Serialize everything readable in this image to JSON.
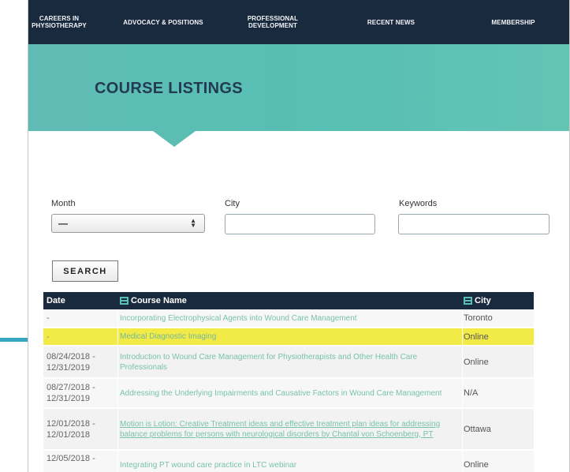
{
  "nav": {
    "items": [
      "CAREERS IN\nPHYSIOTHERAPY",
      "ADVOCACY & POSITIONS",
      "PROFESSIONAL\nDEVELOPMENT",
      "RECENT NEWS",
      "MEMBERSHIP"
    ]
  },
  "hero": {
    "title": "COURSE LISTINGS"
  },
  "filters": {
    "month_label": "Month",
    "month_value": "—",
    "city_label": "City",
    "city_value": "",
    "keywords_label": "Keywords",
    "keywords_value": ""
  },
  "search_button": "SEARCH",
  "table": {
    "headers": {
      "date": "Date",
      "name": "Course Name",
      "city": "City"
    },
    "rows": [
      {
        "date": "-",
        "name": "Incorporating Electrophysical Agents into Wound Care Management",
        "city": "Toronto"
      },
      {
        "date": "-",
        "name": "Medical Diagnostic Imaging",
        "city": "Online"
      },
      {
        "date": "08/24/2018 -\n12/31/2019",
        "name": "Introduction to Wound Care Management for Physiotherapists and Other Health Care Professionals",
        "city": "Online"
      },
      {
        "date": "08/27/2018 -\n12/31/2019",
        "name": "Addressing the Underlying Impairments and Causative Factors in Wound Care Management",
        "city": "N/A"
      },
      {
        "date": "12/01/2018 -\n12/01/2018",
        "name": "Motion is Lotion: Creative Treatment ideas and effective treatment plan ideas for addressing balance problems for persons with neurological disorders by Chantal von Schoenberg, PT",
        "city": "Ottawa"
      },
      {
        "date": "12/05/2018 -",
        "name": "Integrating PT wound care practice in LTC webinar",
        "city": "Online"
      }
    ]
  },
  "colors": {
    "nav_bg": "#1a2a3e",
    "hero_bg": "#57bfb3",
    "title_color": "#233a53",
    "link_color": "#78c3aa",
    "highlight": "#f2ea46",
    "callout": "#39a6c5"
  }
}
